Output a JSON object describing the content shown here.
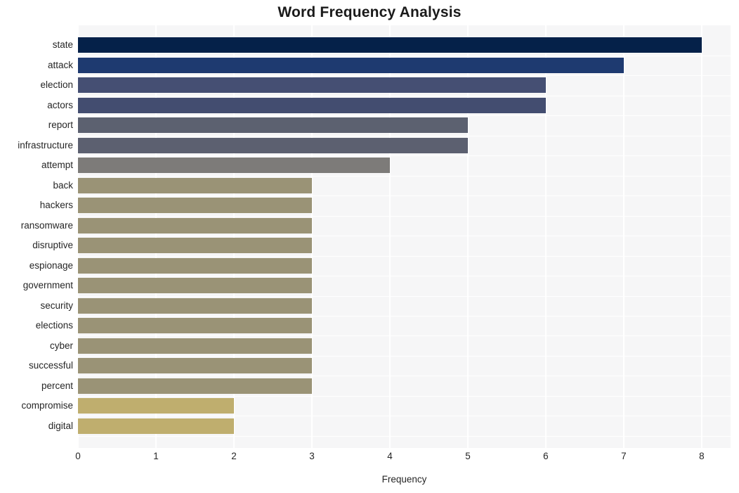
{
  "chart_data": {
    "type": "bar",
    "orientation": "horizontal",
    "title": "Word Frequency Analysis",
    "xlabel": "Frequency",
    "ylabel": "",
    "xlim": [
      0,
      8.37
    ],
    "xticks": [
      0,
      1,
      2,
      3,
      4,
      5,
      6,
      7,
      8
    ],
    "xticklabels": [
      "0",
      "1",
      "2",
      "3",
      "4",
      "5",
      "6",
      "7",
      "8"
    ],
    "grid": true,
    "legend": false,
    "categories": [
      "state",
      "attack",
      "election",
      "actors",
      "report",
      "infrastructure",
      "attempt",
      "back",
      "hackers",
      "ransomware",
      "disruptive",
      "espionage",
      "government",
      "security",
      "elections",
      "cyber",
      "successful",
      "percent",
      "compromise",
      "digital"
    ],
    "values": [
      8,
      7,
      6,
      6,
      5,
      5,
      4,
      3,
      3,
      3,
      3,
      3,
      3,
      3,
      3,
      3,
      3,
      3,
      2,
      2
    ],
    "bar_colors": [
      "#052149",
      "#1e3a70",
      "#454f73",
      "#434d70",
      "#5c6170",
      "#5c6070",
      "#7d7b79",
      "#9a9376",
      "#9a9376",
      "#9a9376",
      "#9a9376",
      "#9a9376",
      "#9a9376",
      "#9a9376",
      "#9a9376",
      "#9a9376",
      "#9a9376",
      "#9a9376",
      "#bfae6e",
      "#bfae6e"
    ],
    "plot_background": "#f6f6f7",
    "gridline_color": "#ffffff",
    "figure_background": "#ffffff"
  }
}
